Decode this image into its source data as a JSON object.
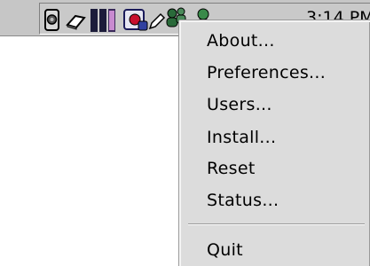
{
  "taskbar": {
    "tray_icons": [
      "speaker-icon",
      "eraser-icon",
      "monitor-bars-icon",
      "network-globe-icon",
      "pencil-icon",
      "people-icon",
      "user-icon"
    ],
    "clock": "3:14 PM"
  },
  "menu": {
    "items": [
      {
        "label": "About..."
      },
      {
        "label": "Preferences..."
      },
      {
        "label": "Users..."
      },
      {
        "label": "Install..."
      },
      {
        "label": "Reset"
      },
      {
        "label": "Status..."
      }
    ],
    "quit_label": "Quit"
  },
  "colors": {
    "taskbar_bg": "#c6c6c6",
    "menu_bg": "#dcdcdc",
    "text": "#000000"
  }
}
